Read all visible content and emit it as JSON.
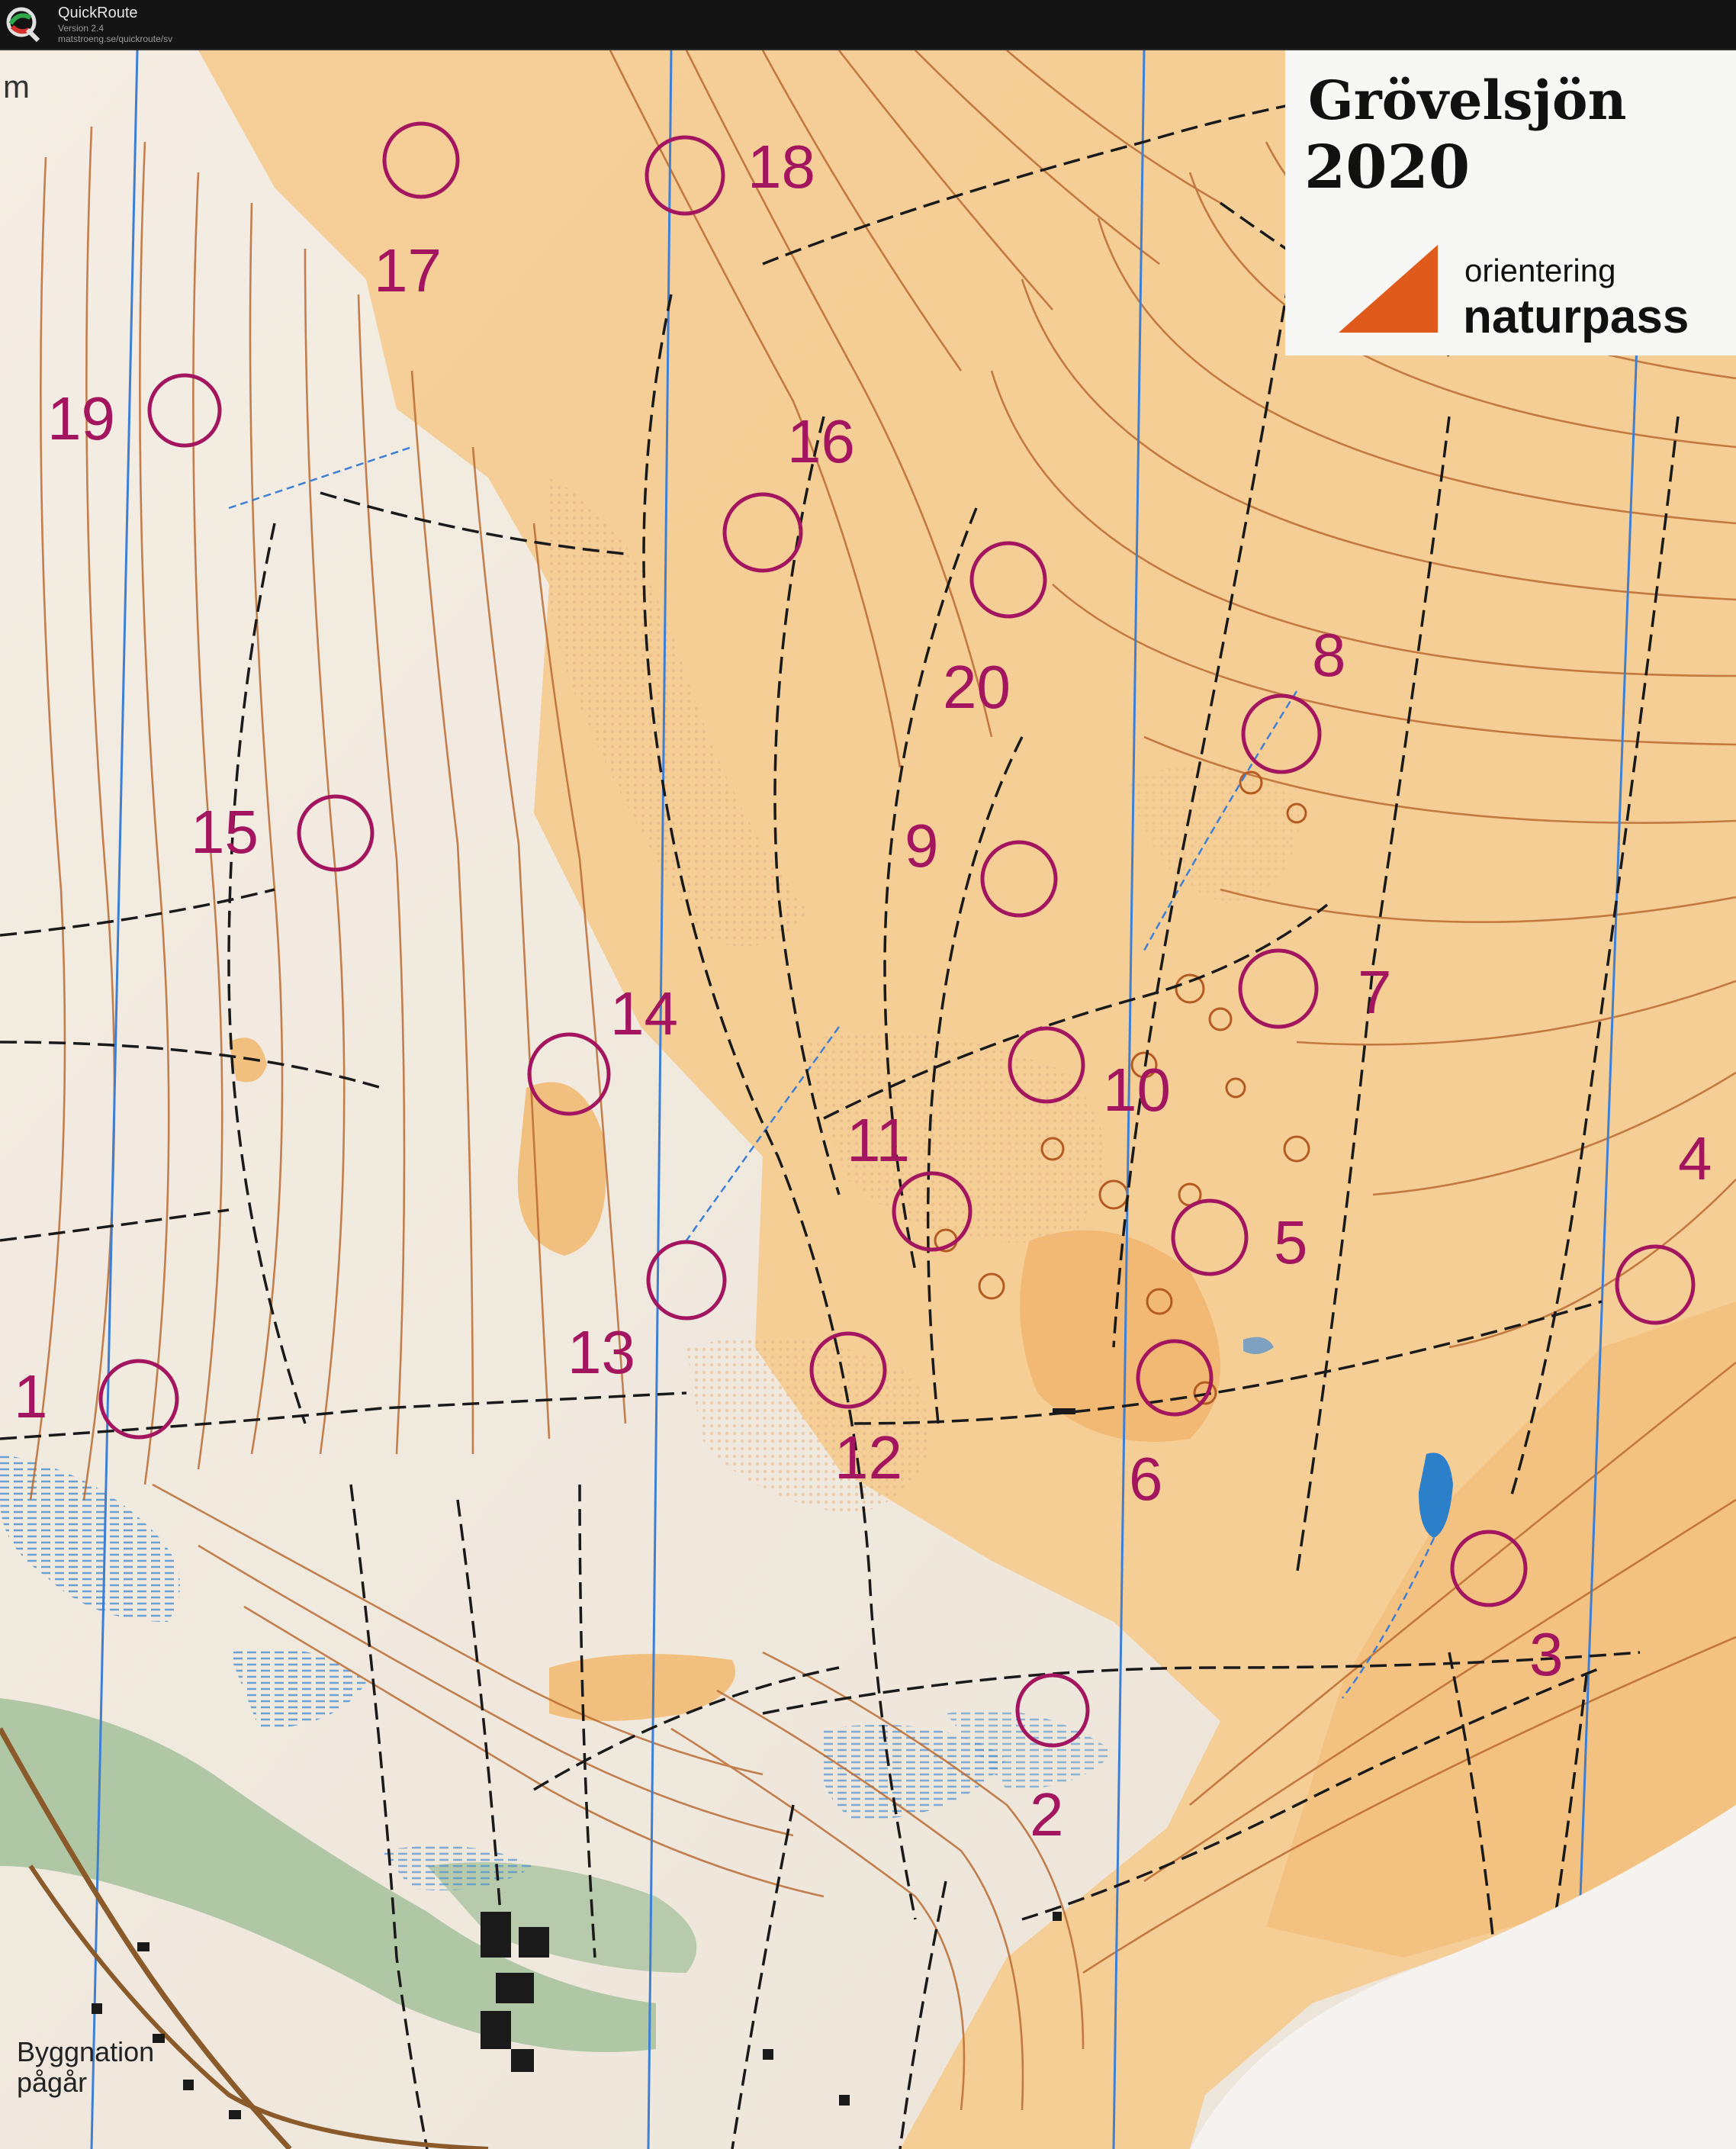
{
  "app": {
    "title": "QuickRoute",
    "version": "Version 2.4",
    "url": "matstroeng.se/quickroute/sv"
  },
  "map": {
    "title_line1": "Grövelsjön",
    "title_line2": "2020",
    "brand_line1": "orientering",
    "brand_line2": "naturpass",
    "corner_text": "m",
    "note_line1": "Byggnation",
    "note_line2": "pågår",
    "control_color": "#a3155e",
    "controls": [
      {
        "label": "1"
      },
      {
        "label": "2"
      },
      {
        "label": "3"
      },
      {
        "label": "4"
      },
      {
        "label": "5"
      },
      {
        "label": "6"
      },
      {
        "label": "7"
      },
      {
        "label": "8"
      },
      {
        "label": "9"
      },
      {
        "label": "10"
      },
      {
        "label": "11"
      },
      {
        "label": "12"
      },
      {
        "label": "13"
      },
      {
        "label": "14"
      },
      {
        "label": "15"
      },
      {
        "label": "16"
      },
      {
        "label": "17"
      },
      {
        "label": "18"
      },
      {
        "label": "19"
      },
      {
        "label": "20"
      }
    ]
  }
}
